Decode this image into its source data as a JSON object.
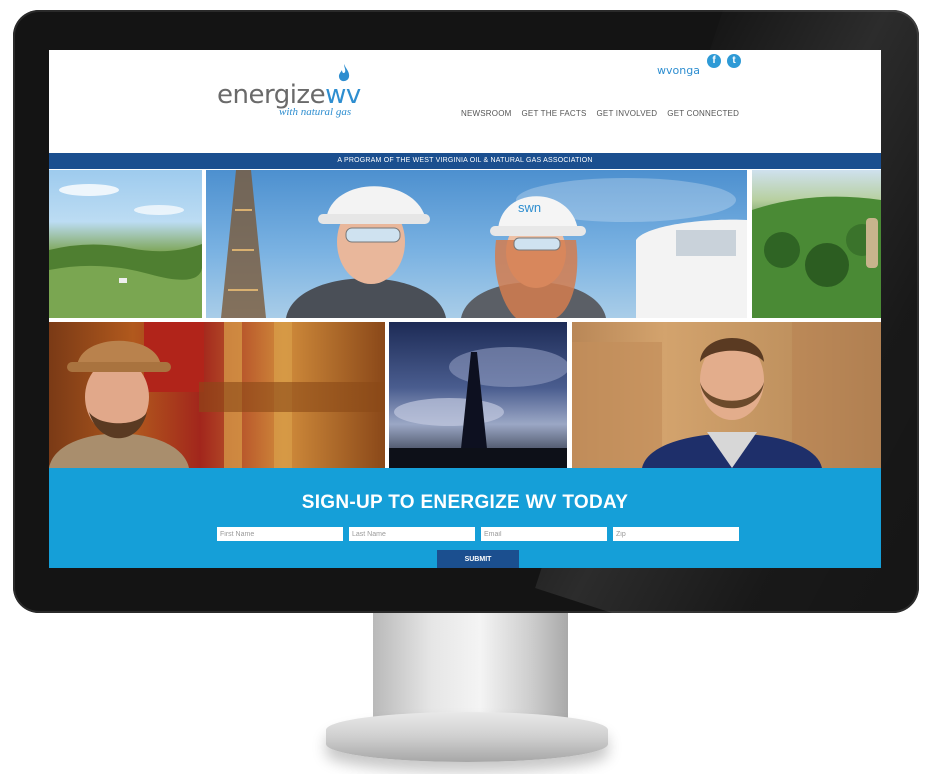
{
  "logo": {
    "word": "energize",
    "wv": "wv",
    "tagline": "with natural gas"
  },
  "partner_logo": {
    "text": "wvonga"
  },
  "social": [
    {
      "name": "facebook",
      "glyph": "f",
      "icon": "facebook-icon"
    },
    {
      "name": "twitter",
      "glyph": "t",
      "icon": "twitter-icon"
    }
  ],
  "nav": {
    "items": [
      {
        "label": "NEWSROOM"
      },
      {
        "label": "GET THE FACTS"
      },
      {
        "label": "GET INVOLVED"
      },
      {
        "label": "GET CONNECTED"
      }
    ]
  },
  "program_bar": {
    "text": "A PROGRAM OF THE WEST VIRGINIA OIL & NATURAL GAS ASSOCIATION"
  },
  "photos": {
    "workers": {
      "hardhat_text": "swn"
    }
  },
  "signup": {
    "title": "SIGN-UP TO ENERGIZE WV TODAY",
    "fields": {
      "first_name_placeholder": "First Name",
      "last_name_placeholder": "Last Name",
      "email_placeholder": "Email",
      "zip_placeholder": "Zip"
    },
    "submit_label": "SUBMIT"
  },
  "colors": {
    "brand_blue": "#2e8ed0",
    "navy": "#1b4f8f",
    "signup_blue": "#159fd8"
  }
}
